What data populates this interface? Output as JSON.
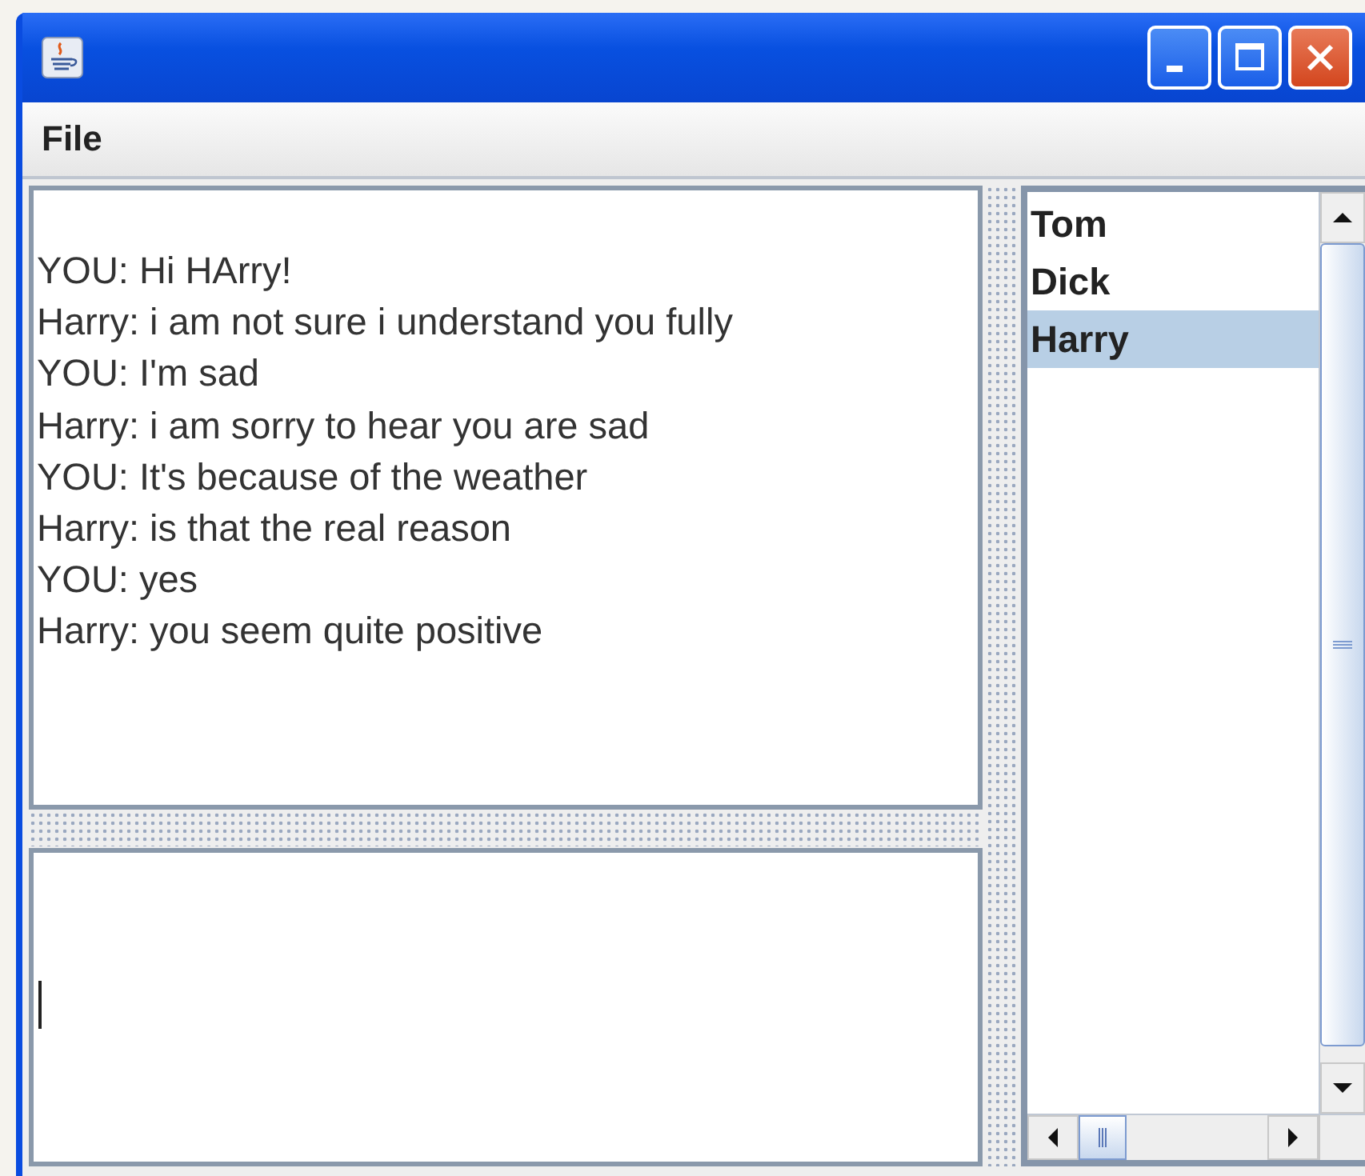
{
  "menu_bar": [
    "File"
  ],
  "chat_log": [
    "YOU: Hi HArry!",
    "Harry: i am not sure i understand you fully",
    "YOU: I'm sad",
    "Harry: i am sorry to hear you are sad",
    "YOU: It's because of the weather",
    "Harry: is that the real reason",
    "YOU: yes",
    "Harry: you seem quite positive"
  ],
  "contacts": [
    {
      "name": "Tom",
      "selected": false
    },
    {
      "name": "Dick",
      "selected": false
    },
    {
      "name": "Harry",
      "selected": true
    }
  ]
}
